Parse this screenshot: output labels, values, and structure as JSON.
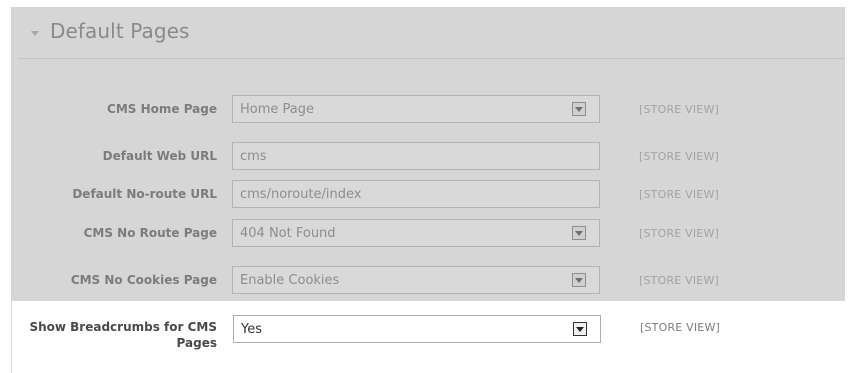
{
  "section": {
    "title": "Default Pages"
  },
  "rows": [
    {
      "label": "CMS Home Page",
      "value": "Home Page",
      "type": "select",
      "scope": "[STORE VIEW]"
    },
    {
      "label": "Default Web URL",
      "value": "cms",
      "type": "text",
      "scope": "[STORE VIEW]"
    },
    {
      "label": "Default No-route URL",
      "value": "cms/noroute/index",
      "type": "text",
      "scope": "[STORE VIEW]"
    },
    {
      "label": "CMS No Route Page",
      "value": "404 Not Found",
      "type": "select",
      "scope": "[STORE VIEW]"
    },
    {
      "label": "CMS No Cookies Page",
      "value": "Enable Cookies",
      "type": "select",
      "scope": "[STORE VIEW]"
    }
  ],
  "active_row": {
    "label": "Show Breadcrumbs for CMS Pages",
    "value": "Yes",
    "scope": "[STORE VIEW]"
  },
  "colors": {
    "overlay": "#d6d6d6",
    "active_background": "#ffffff"
  }
}
